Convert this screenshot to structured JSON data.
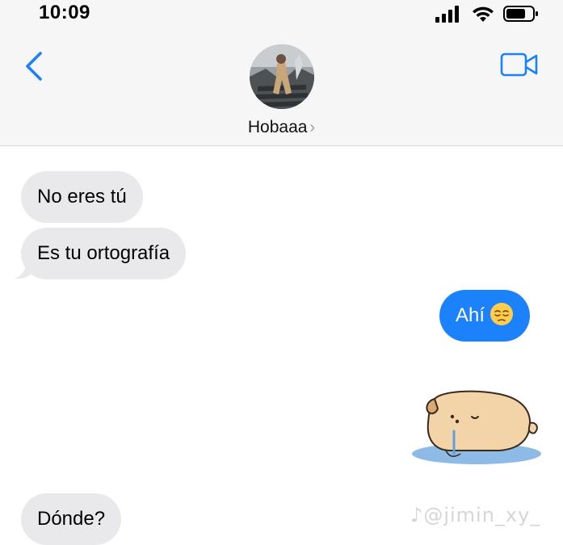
{
  "status_bar": {
    "time": "10:09"
  },
  "header": {
    "back_icon": "chevron-left-icon",
    "video_icon": "video-camera-icon",
    "contact_name": "Hobaaa",
    "chevron": "›"
  },
  "messages": [
    {
      "side": "in",
      "text": "No eres tú"
    },
    {
      "side": "in",
      "text": "Es tu ortografía"
    },
    {
      "side": "out",
      "text": "Ahí",
      "emoji": "pensive-face"
    },
    {
      "side": "out",
      "sticker": "sleeping-dog-sticker"
    },
    {
      "side": "in",
      "text": "Dónde?"
    }
  ],
  "watermark": "@jimin_xy_",
  "colors": {
    "outgoing": "#1b82fb",
    "incoming": "#e9e9eb",
    "accent": "#1b82fb"
  }
}
